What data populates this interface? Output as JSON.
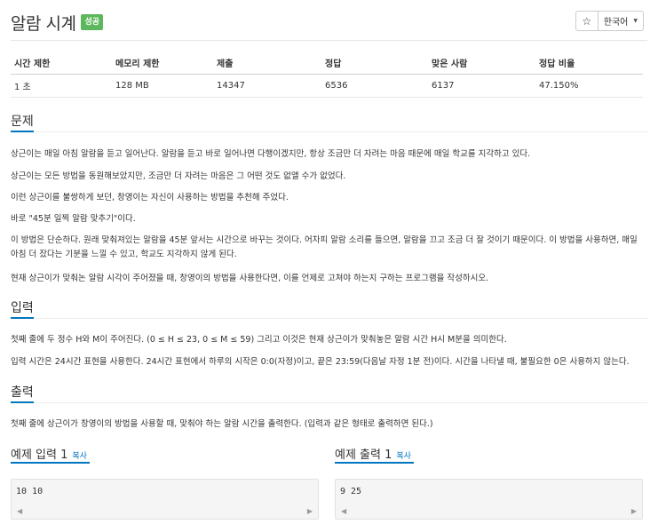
{
  "problem": {
    "title": "알람 시계",
    "badge": "성공"
  },
  "actions": {
    "star_glyph": "☆",
    "language": "한국어",
    "caret_glyph": "▼"
  },
  "info_table": {
    "headers": [
      "시간 제한",
      "메모리 제한",
      "제출",
      "정답",
      "맞은 사람",
      "정답 비율"
    ],
    "row": [
      "1 초",
      "128 MB",
      "14347",
      "6536",
      "6137",
      "47.150%"
    ]
  },
  "sections": {
    "problem_title": "문제",
    "problem_paragraphs": [
      "상근이는 매일 아침 알람을 듣고 일어난다. 알람을 듣고 바로 일어나면 다행이겠지만, 항상 조금만 더 자려는 마음 때문에 매일 학교를 지각하고 있다.",
      "상근이는 모든 방법을 동원해보았지만, 조금만 더 자려는 마음은 그 어떤 것도 없앨 수가 없었다.",
      "이런 상근이를 불쌍하게 보던, 창영이는 자신이 사용하는 방법을 추천해 주었다.",
      "바로 \"45분 일찍 알람 맞추기\"이다.",
      "이 방법은 단순하다. 원래 맞춰져있는 알람을 45분 앞서는 시간으로 바꾸는 것이다. 어차피 알람 소리를 들으면, 알람을 끄고 조금 더 잘 것이기 때문이다. 이 방법을 사용하면, 매일 아침 더 잤다는 기분을 느낄 수 있고, 학교도 지각하지 않게 된다.",
      "현재 상근이가 맞춰논 알람 시각이 주어졌을 때, 창영이의 방법을 사용한다면, 이를 언제로 고쳐야 하는지 구하는 프로그램을 작성하시오."
    ],
    "input_title": "입력",
    "input_paragraphs": [
      "첫째 줄에 두 정수 H와 M이 주어진다. (0 ≤ H ≤ 23, 0 ≤ M ≤ 59) 그리고 이것은 현재 상근이가 맞춰놓은 알람 시간 H시 M분을 의미한다.",
      "입력 시간은 24시간 표현을 사용한다. 24시간 표현에서 하루의 시작은 0:0(자정)이고, 끝은 23:59(다음날 자정 1분 전)이다. 시간을 나타낼 때, 불필요한 0은 사용하지 않는다."
    ],
    "output_title": "출력",
    "output_paragraphs": [
      "첫째 줄에 상근이가 창영이의 방법을 사용할 때, 맞춰야 하는 알람 시간을 출력한다. (입력과 같은 형태로 출력하면 된다.)"
    ]
  },
  "samples": {
    "input_label": "예제 입력 1",
    "output_label": "예제 출력 1",
    "copy_label": "복사",
    "input_value": "10 10",
    "output_value": "9 25",
    "scroll_left_glyph": "◀",
    "scroll_right_glyph": "▶"
  },
  "colors": {
    "badge_green": "#5cb85c",
    "accent_blue": "#0076c0"
  }
}
